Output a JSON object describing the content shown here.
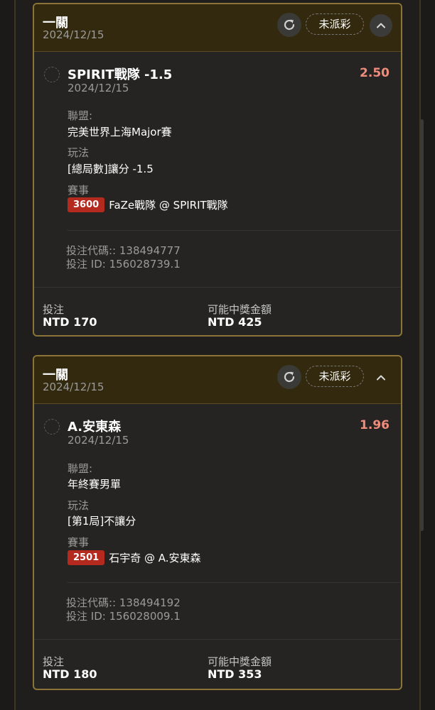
{
  "bets": [
    {
      "header_title": "一關",
      "header_date": "2024/12/15",
      "status": "未派彩",
      "selection": "SPIRIT戰隊 -1.5",
      "selection_date": "2024/12/15",
      "odds": "2.50",
      "league_label": "聯盟:",
      "league": "完美世界上海Major賽",
      "market_label": "玩法",
      "market": "[總局數]讓分 -1.5",
      "event_label": "賽事",
      "event_id": "3600",
      "event": "FaZe戰隊 @ SPIRIT戰隊",
      "bet_code": "投注代碼:: 138494777",
      "bet_id": "投注 ID: 156028739.1",
      "stake_label": "投注",
      "stake": "NTD 170",
      "payout_label": "可能中獎金額",
      "payout": "NTD 425"
    },
    {
      "header_title": "一關",
      "header_date": "2024/12/15",
      "status": "未派彩",
      "selection": "A.安東森",
      "selection_date": "2024/12/15",
      "odds": "1.96",
      "league_label": "聯盟:",
      "league": "年終賽男單",
      "market_label": "玩法",
      "market": "[第1局]不讓分",
      "event_label": "賽事",
      "event_id": "2501",
      "event": "石宇奇 @ A.安東森",
      "bet_code": "投注代碼:: 138494192",
      "bet_id": "投注 ID: 156028009.1",
      "stake_label": "投注",
      "stake": "NTD 180",
      "payout_label": "可能中獎金額",
      "payout": "NTD 353"
    }
  ],
  "icons": {
    "refresh": "refresh-icon",
    "collapse": "chevron-up-icon"
  },
  "colors": {
    "accent_border": "#8c7438",
    "odds": "#f08c7c",
    "event_badge": "#b52a1f"
  }
}
